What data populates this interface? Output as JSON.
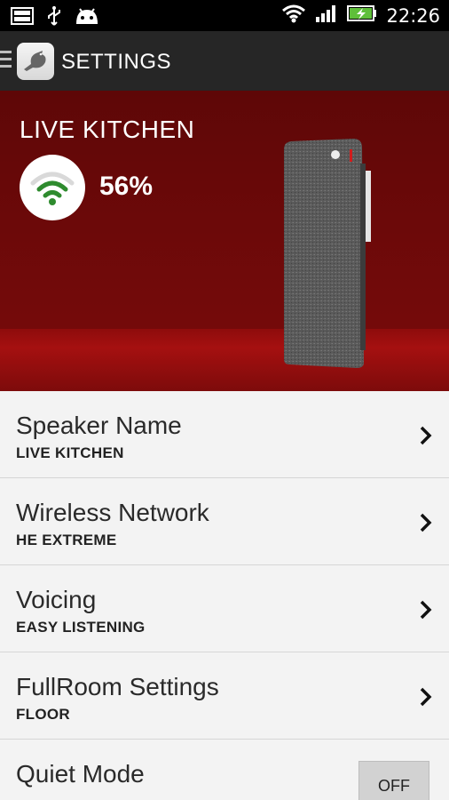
{
  "status_bar": {
    "time": "22:26",
    "icons": [
      "image-notification-icon",
      "usb-icon",
      "android-debug-icon",
      "wifi-icon",
      "signal-icon",
      "battery-charging-icon"
    ]
  },
  "action_bar": {
    "title": "SETTINGS",
    "logo_icon": "bird-logo-icon"
  },
  "hero": {
    "speaker_name": "LIVE KITCHEN",
    "signal_strength": "56%",
    "background_color": "#6c0909"
  },
  "settings": [
    {
      "title": "Speaker Name",
      "value": "LIVE KITCHEN"
    },
    {
      "title": "Wireless Network",
      "value": "HE EXTREME"
    },
    {
      "title": "Voicing",
      "value": "EASY LISTENING"
    },
    {
      "title": "FullRoom Settings",
      "value": "FLOOR"
    }
  ],
  "quiet_mode": {
    "title": "Quiet Mode",
    "toggle_label": "OFF"
  },
  "colors": {
    "wifi_green": "#2e8b2e",
    "accent_red": "#7a0b0b"
  }
}
